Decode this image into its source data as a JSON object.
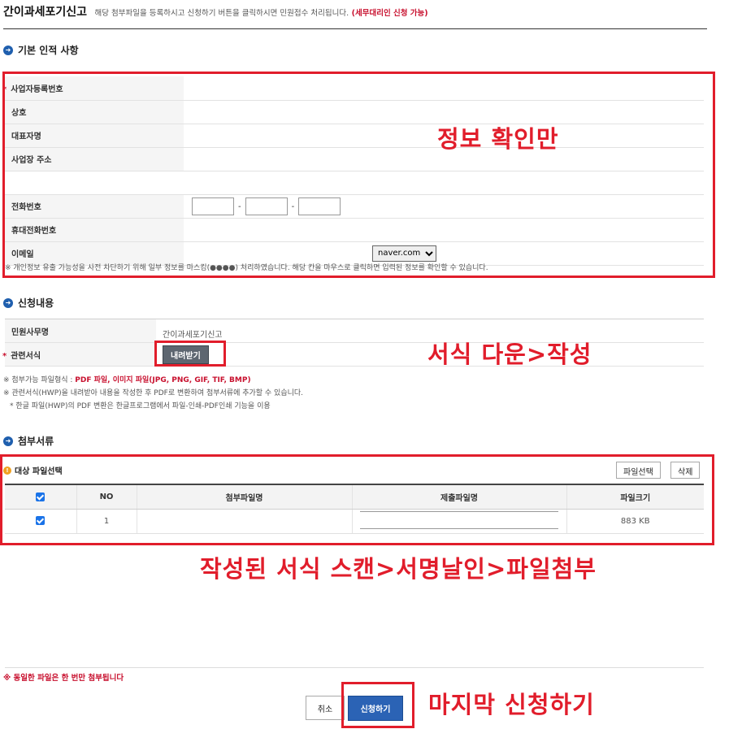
{
  "header": {
    "title": "간이과세포기신고",
    "description": "해당 첨부파일을 등록하시고 신청하기 버튼을 클릭하시면 민원접수 처리됩니다.",
    "note": "(세무대리인 신청 가능)"
  },
  "basic_info": {
    "section_title": "기본 인적 사항",
    "fields": {
      "business_no": "사업자등록번호",
      "company": "상호",
      "representative": "대표자명",
      "address": "사업장 주소",
      "phone": "전화번호",
      "mobile": "휴대전화번호",
      "email": "이메일"
    },
    "phone_dash": "-",
    "email_domain": "naver.com",
    "privacy_note": "※ 개인정보 유출 가능성을 사전 차단하기 위해 일부 정보를 마스킹(●●●●) 처리하였습니다. 해당 칸을 마우스로 클릭하면 입력된 정보를 확인할 수 있습니다."
  },
  "application": {
    "section_title": "신청내용",
    "service_label": "민원사무명",
    "service_value": "간이과세포기신고",
    "form_label": "관련서식",
    "download_button": "내려받기",
    "notes": {
      "file_types_prefix": "※ 첨부가능 파일형식 : ",
      "file_types": "PDF 파일, 이미지 파일(JPG, PNG, GIF, TIF, BMP)",
      "hwp_note": "※ 관련서식(HWP)을 내려받아 내용을 작성한 후 PDF로 변환하여 첨부서류에 추가할 수 있습니다.",
      "convert_note": "* 한글 파일(HWP)의 PDF 변환은 한글프로그램에서 파일-인쇄-PDF인쇄 기능을 이용"
    }
  },
  "attachments": {
    "section_title": "첨부서류",
    "target_label": "대상 파일선택",
    "select_button": "파일선택",
    "delete_button": "삭제",
    "columns": [
      "NO",
      "첨부파일명",
      "제출파일명",
      "파일크기"
    ],
    "rows": [
      {
        "no": "1",
        "size": "883 KB"
      }
    ]
  },
  "footer": {
    "same_file_note": "※ 동일한 파일은 한 번만 첨부됩니다",
    "cancel_button": "취소",
    "submit_button": "신청하기"
  },
  "annotations": {
    "info_check": "정보 확인만",
    "form_download": "서식 다운>작성",
    "scan_attach": "작성된 서식 스캔>서명날인>파일첨부",
    "final_submit": "마지막 신청하기"
  },
  "colors": {
    "annotation_red": "#e11d2b",
    "accent_blue": "#1f5fae",
    "note_red": "#c8102e"
  }
}
